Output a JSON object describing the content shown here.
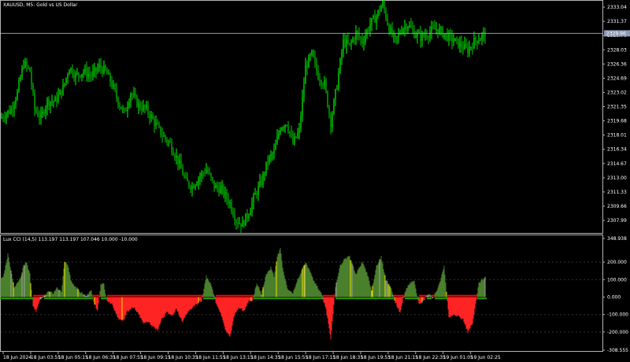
{
  "window": {
    "title": "XAUUSD, M5:  Gold vs US Dollar",
    "bid_price": "2329.96"
  },
  "indicator": {
    "title": "Lux CCI (14,5) 113.197 113.197 107.046 10.000 -10.000"
  },
  "colors": {
    "background": "#000000",
    "bull": "#00ff00",
    "bear": "#00cc00",
    "frame": "#b4b4b4",
    "grid": "#333333",
    "bid_line": "#8c9bb4",
    "hist_pos": "#4a7f2c",
    "hist_neg": "#ff2424",
    "hist_mid": "#a0a0a0",
    "hist_yellow": "#e8e000",
    "signal_neg": "#ff0000",
    "signal_pos": "#2aa000"
  },
  "price_axis": {
    "ticks": [
      "2333.04",
      "2331.37",
      "2329.70",
      "2328.03",
      "2326.36",
      "2324.69",
      "2323.02",
      "2321.35",
      "2319.68",
      "2318.01",
      "2316.34",
      "2314.67",
      "2313.00",
      "2311.33",
      "2309.66",
      "2307.99"
    ],
    "min": 2306.7,
    "max": 2333.6
  },
  "cci_axis": {
    "ticks": [
      "348.938",
      "200.000",
      "100.000",
      "0.000",
      "-100.000",
      "-200.000",
      "-308.555"
    ],
    "min": -308.555,
    "max": 348.938
  },
  "time_axis": {
    "labels": [
      "18 Jun 2024",
      "18 Jun 03:55",
      "18 Jun 05:15",
      "18 Jun 06:35",
      "18 Jun 07:55",
      "18 Jun 09:15",
      "18 Jun 10:35",
      "18 Jun 11:55",
      "18 Jun 13:15",
      "18 Jun 14:35",
      "18 Jun 15:55",
      "18 Jun 17:15",
      "18 Jun 18:35",
      "18 Jun 19:55",
      "18 Jun 21:15",
      "18 Jun 22:35",
      "19 Jun 01:05",
      "19 Jun 02:25"
    ]
  },
  "price_path": [
    [
      0,
      2320.0
    ],
    [
      14,
      2321.0
    ],
    [
      22,
      2323.0
    ],
    [
      30,
      2326.5
    ],
    [
      38,
      2325.5
    ],
    [
      44,
      2321.0
    ],
    [
      52,
      2320.0
    ],
    [
      60,
      2322.0
    ],
    [
      70,
      2322.0
    ],
    [
      80,
      2323.5
    ],
    [
      88,
      2326.0
    ],
    [
      96,
      2325.0
    ],
    [
      106,
      2325.5
    ],
    [
      116,
      2325.0
    ],
    [
      126,
      2326.0
    ],
    [
      134,
      2325.5
    ],
    [
      142,
      2324.0
    ],
    [
      150,
      2322.0
    ],
    [
      158,
      2320.5
    ],
    [
      166,
      2323.0
    ],
    [
      176,
      2321.5
    ],
    [
      186,
      2321.0
    ],
    [
      196,
      2319.5
    ],
    [
      206,
      2318.0
    ],
    [
      216,
      2317.0
    ],
    [
      226,
      2315.0
    ],
    [
      236,
      2312.5
    ],
    [
      244,
      2312.0
    ],
    [
      252,
      2313.0
    ],
    [
      262,
      2314.0
    ],
    [
      272,
      2312.0
    ],
    [
      282,
      2311.5
    ],
    [
      292,
      2310.0
    ],
    [
      300,
      2308.0
    ],
    [
      308,
      2307.5
    ],
    [
      316,
      2309.0
    ],
    [
      324,
      2311.0
    ],
    [
      332,
      2312.5
    ],
    [
      340,
      2315.0
    ],
    [
      348,
      2316.0
    ],
    [
      356,
      2319.0
    ],
    [
      364,
      2319.5
    ],
    [
      372,
      2317.0
    ],
    [
      380,
      2318.5
    ],
    [
      388,
      2326.0
    ],
    [
      396,
      2327.5
    ],
    [
      404,
      2325.0
    ],
    [
      412,
      2324.0
    ],
    [
      420,
      2319.5
    ],
    [
      428,
      2324.0
    ],
    [
      436,
      2329.0
    ],
    [
      444,
      2328.5
    ],
    [
      452,
      2330.0
    ],
    [
      460,
      2329.0
    ],
    [
      470,
      2331.0
    ],
    [
      478,
      2332.0
    ],
    [
      486,
      2333.5
    ],
    [
      494,
      2330.5
    ],
    [
      502,
      2329.0
    ],
    [
      510,
      2330.5
    ],
    [
      518,
      2331.0
    ],
    [
      526,
      2330.0
    ],
    [
      534,
      2329.5
    ],
    [
      544,
      2330.0
    ],
    [
      554,
      2330.5
    ],
    [
      562,
      2330.0
    ],
    [
      570,
      2329.5
    ],
    [
      578,
      2329.0
    ],
    [
      586,
      2328.5
    ],
    [
      594,
      2328.0
    ],
    [
      602,
      2329.0
    ],
    [
      610,
      2329.5
    ],
    [
      616,
      2330.0
    ]
  ],
  "cci_path": [
    [
      0,
      100
    ],
    [
      4,
      120
    ],
    [
      8,
      200
    ],
    [
      10,
      245
    ],
    [
      14,
      150
    ],
    [
      18,
      60
    ],
    [
      22,
      80
    ],
    [
      26,
      110
    ],
    [
      30,
      180
    ],
    [
      34,
      200
    ],
    [
      38,
      130
    ],
    [
      42,
      -50
    ],
    [
      46,
      -80
    ],
    [
      50,
      -20
    ],
    [
      56,
      10
    ],
    [
      62,
      30
    ],
    [
      68,
      20
    ],
    [
      72,
      50
    ],
    [
      78,
      30
    ],
    [
      82,
      200
    ],
    [
      86,
      190
    ],
    [
      90,
      100
    ],
    [
      96,
      60
    ],
    [
      102,
      30
    ],
    [
      110,
      10
    ],
    [
      116,
      40
    ],
    [
      120,
      -40
    ],
    [
      124,
      -80
    ],
    [
      128,
      80
    ],
    [
      132,
      70
    ],
    [
      136,
      -20
    ],
    [
      142,
      -40
    ],
    [
      150,
      -120
    ],
    [
      156,
      -140
    ],
    [
      162,
      -80
    ],
    [
      170,
      -60
    ],
    [
      176,
      -100
    ],
    [
      182,
      -150
    ],
    [
      188,
      -140
    ],
    [
      194,
      -170
    ],
    [
      200,
      -190
    ],
    [
      206,
      -120
    ],
    [
      212,
      -90
    ],
    [
      218,
      -110
    ],
    [
      224,
      -70
    ],
    [
      232,
      -140
    ],
    [
      238,
      -90
    ],
    [
      244,
      -60
    ],
    [
      250,
      -40
    ],
    [
      256,
      -20
    ],
    [
      262,
      120
    ],
    [
      268,
      70
    ],
    [
      274,
      -30
    ],
    [
      280,
      -90
    ],
    [
      286,
      -180
    ],
    [
      292,
      -230
    ],
    [
      298,
      -100
    ],
    [
      304,
      -60
    ],
    [
      310,
      -80
    ],
    [
      316,
      -20
    ],
    [
      320,
      -30
    ],
    [
      326,
      80
    ],
    [
      332,
      20
    ],
    [
      338,
      130
    ],
    [
      344,
      170
    ],
    [
      348,
      120
    ],
    [
      352,
      230
    ],
    [
      356,
      280
    ],
    [
      360,
      140
    ],
    [
      366,
      40
    ],
    [
      372,
      20
    ],
    [
      378,
      100
    ],
    [
      384,
      160
    ],
    [
      388,
      200
    ],
    [
      394,
      140
    ],
    [
      400,
      80
    ],
    [
      408,
      20
    ],
    [
      414,
      -70
    ],
    [
      420,
      -240
    ],
    [
      426,
      60
    ],
    [
      432,
      180
    ],
    [
      438,
      220
    ],
    [
      444,
      230
    ],
    [
      452,
      130
    ],
    [
      460,
      200
    ],
    [
      466,
      140
    ],
    [
      472,
      40
    ],
    [
      478,
      180
    ],
    [
      484,
      230
    ],
    [
      490,
      100
    ],
    [
      496,
      60
    ],
    [
      502,
      -30
    ],
    [
      508,
      -90
    ],
    [
      514,
      30
    ],
    [
      520,
      80
    ],
    [
      526,
      90
    ],
    [
      532,
      -40
    ],
    [
      538,
      -20
    ],
    [
      544,
      20
    ],
    [
      550,
      -10
    ],
    [
      558,
      80
    ],
    [
      564,
      180
    ],
    [
      570,
      -120
    ],
    [
      576,
      -100
    ],
    [
      582,
      -110
    ],
    [
      588,
      -130
    ],
    [
      594,
      -200
    ],
    [
      600,
      -150
    ],
    [
      604,
      -40
    ],
    [
      608,
      80
    ],
    [
      612,
      100
    ],
    [
      616,
      110
    ]
  ]
}
